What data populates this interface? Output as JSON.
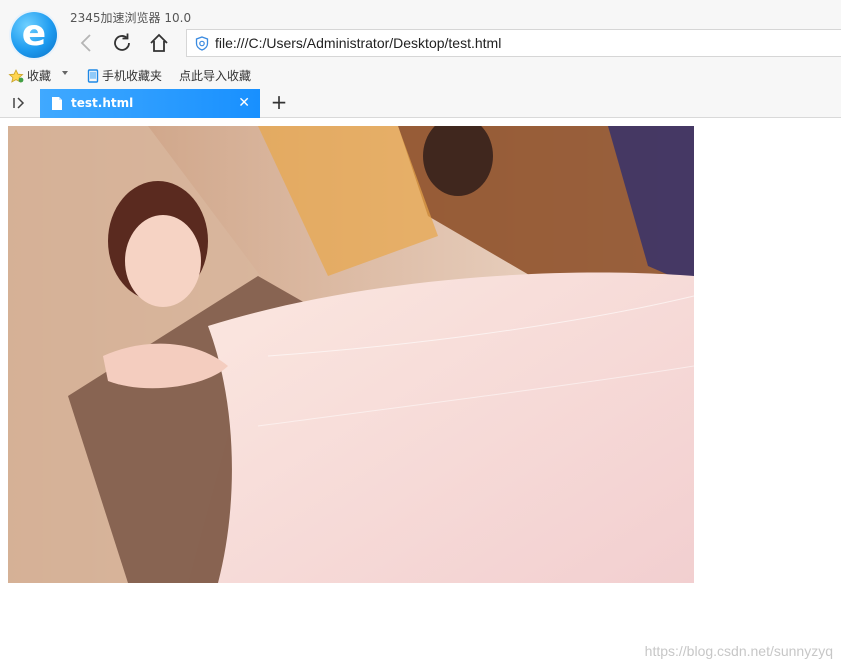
{
  "app": {
    "title": "2345加速浏览器 10.0",
    "logo_icon": "browser-logo-e"
  },
  "nav": {
    "back_icon": "chevron-left-icon",
    "refresh_icon": "refresh-icon",
    "home_icon": "home-icon"
  },
  "address_bar": {
    "url": "file:///C:/Users/Administrator/Desktop/test.html",
    "security_icon": "shield-icon"
  },
  "bookmarks": {
    "favorites_label": "收藏",
    "mobile_label": "手机收藏夹",
    "import_label": "点此导入收藏"
  },
  "tabs": [
    {
      "title": "test.html",
      "active": true
    }
  ],
  "page": {
    "image_alt": "photo",
    "watermark": "https://blog.csdn.net/sunnyzyq"
  },
  "colors": {
    "accent": "#1890ff",
    "tab_gradient_start": "#40a9ff"
  }
}
